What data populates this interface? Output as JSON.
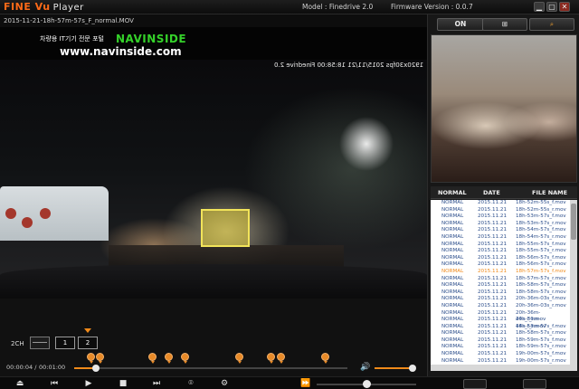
{
  "app": {
    "logo_brand": "FINE Vu",
    "logo_suffix": "Player",
    "model": "Model : Finedrive 2.0",
    "firmware": "Firmware Version : 0.0.7",
    "minimize": "▁",
    "maximize": "▢",
    "close": "✕"
  },
  "video": {
    "filename": "2015-11-21-18h-57m-57s_F_normal.MOV",
    "banner_korean": "차량용 IT기기 전문 포털",
    "banner_brand": "NAVINSIDE",
    "banner_url": "www.navinside.com",
    "osd_text": "1920x30fps 2015/11/21 18:58:00 Finedrive 2.0"
  },
  "channel": {
    "label": "2CH",
    "ch1": "1",
    "ch2": "2"
  },
  "playback": {
    "current": "00:00:04",
    "separator": "/",
    "total": "00:01:00",
    "progress": 0.08,
    "volume": 0.92,
    "speed": 0.5,
    "event_marks": [
      0.06,
      0.095,
      0.285,
      0.345,
      0.405,
      0.605,
      0.72,
      0.755,
      0.92
    ]
  },
  "transport": {
    "eject": "⏏",
    "prev": "⏮",
    "play": "▶",
    "stop": "■",
    "next": "⏭",
    "capture": "⌾",
    "settings": "⚙",
    "fast": "⏩"
  },
  "right": {
    "on_label": "ON",
    "map_label": "⊞",
    "search_label": "⌕"
  },
  "file_list": {
    "headers": [
      "NORMAL",
      "DATE",
      "FILE NAME"
    ],
    "rows": [
      {
        "type": "NORMAL",
        "date": "2015.11.21",
        "name": "18h-52m-55s_f.mov",
        "selected": false
      },
      {
        "type": "NORMAL",
        "date": "2015.11.21",
        "name": "18h-52m-55s_r.mov",
        "selected": false
      },
      {
        "type": "NORMAL",
        "date": "2015.11.21",
        "name": "18h-53m-57s_f.mov",
        "selected": false
      },
      {
        "type": "NORMAL",
        "date": "2015.11.21",
        "name": "18h-53m-57s_r.mov",
        "selected": false
      },
      {
        "type": "NORMAL",
        "date": "2015.11.21",
        "name": "18h-54m-57s_f.mov",
        "selected": false
      },
      {
        "type": "NORMAL",
        "date": "2015.11.21",
        "name": "18h-54m-57s_r.mov",
        "selected": false
      },
      {
        "type": "NORMAL",
        "date": "2015.11.21",
        "name": "18h-55m-57s_f.mov",
        "selected": false
      },
      {
        "type": "NORMAL",
        "date": "2015.11.21",
        "name": "18h-55m-57s_r.mov",
        "selected": false
      },
      {
        "type": "NORMAL",
        "date": "2015.11.21",
        "name": "18h-56m-57s_f.mov",
        "selected": false
      },
      {
        "type": "NORMAL",
        "date": "2015.11.21",
        "name": "18h-56m-57s_r.mov",
        "selected": false
      },
      {
        "type": "NORMAL",
        "date": "2015.11.21",
        "name": "18h-57m-57s_f.mov",
        "selected": true
      },
      {
        "type": "NORMAL",
        "date": "2015.11.21",
        "name": "18h-57m-57s_r.mov",
        "selected": false
      },
      {
        "type": "NORMAL",
        "date": "2015.11.21",
        "name": "18h-58m-57s_f.mov",
        "selected": false
      },
      {
        "type": "NORMAL",
        "date": "2015.11.21",
        "name": "18h-58m-57s_r.mov",
        "selected": false
      },
      {
        "type": "NORMAL",
        "date": "2015.11.21",
        "name": "20h-36m-03s_f.mov",
        "selected": false
      },
      {
        "type": "NORMAL",
        "date": "2015.11.21",
        "name": "20h-36m-03s_r.mov",
        "selected": false
      },
      {
        "type": "NORMAL",
        "date": "2015.11.21",
        "name": "20h-36m-44s_f_r.mov",
        "selected": false
      },
      {
        "type": "NORMAL",
        "date": "2015.11.21",
        "name": "20h-36m-44s_f_r.mov",
        "selected": false
      },
      {
        "type": "NORMAL",
        "date": "2015.11.21",
        "name": "18h-58m-57s_f.mov",
        "selected": false
      },
      {
        "type": "NORMAL",
        "date": "2015.11.21",
        "name": "18h-58m-57s_r.mov",
        "selected": false
      },
      {
        "type": "NORMAL",
        "date": "2015.11.21",
        "name": "18h-59m-57s_f.mov",
        "selected": false
      },
      {
        "type": "NORMAL",
        "date": "2015.11.21",
        "name": "18h-59m-57s_r.mov",
        "selected": false
      },
      {
        "type": "NORMAL",
        "date": "2015.11.21",
        "name": "19h-00m-57s_f.mov",
        "selected": false
      },
      {
        "type": "NORMAL",
        "date": "2015.11.21",
        "name": "19h-00m-57s_r.mov",
        "selected": false
      }
    ]
  },
  "colors": {
    "accent": "#f08a1a",
    "list_text": "#2d4f8c",
    "selected_text": "#f08a1a",
    "detection_box": "#f2e45a"
  }
}
